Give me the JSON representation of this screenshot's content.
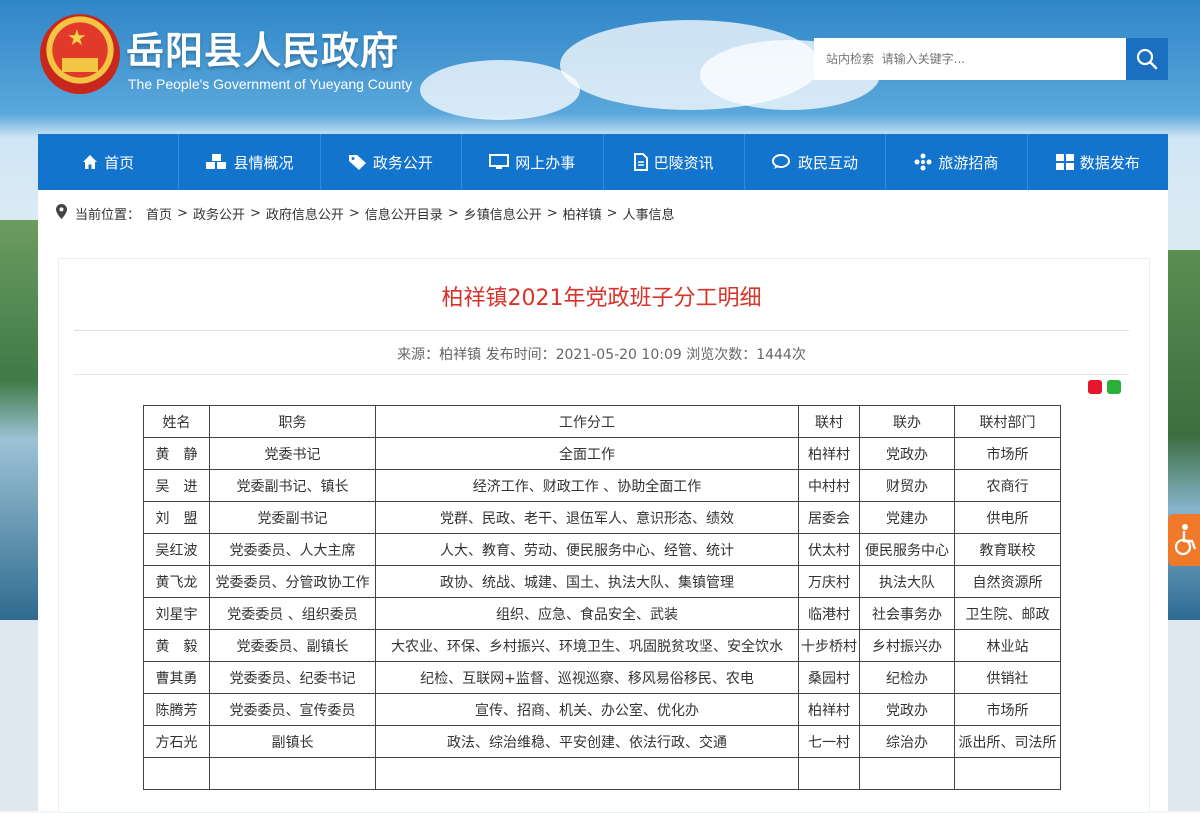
{
  "header": {
    "title": "岳阳县人民政府",
    "subtitle": "The People's Government of Yueyang County",
    "search_placeholder": "站内检索  请输入关键字..."
  },
  "nav": [
    {
      "label": "首页",
      "icon": "home-icon"
    },
    {
      "label": "县情概况",
      "icon": "cubes-icon"
    },
    {
      "label": "政务公开",
      "icon": "tag-icon"
    },
    {
      "label": "网上办事",
      "icon": "monitor-icon"
    },
    {
      "label": "巴陵资讯",
      "icon": "document-icon"
    },
    {
      "label": "政民互动",
      "icon": "chat-icon"
    },
    {
      "label": "旅游招商",
      "icon": "pinwheel-icon"
    },
    {
      "label": "数据发布",
      "icon": "grid-icon"
    }
  ],
  "breadcrumb": {
    "prefix": "当前位置：",
    "items": [
      "首页",
      "政务公开",
      "政府信息公开",
      "信息公开目录",
      "乡镇信息公开",
      "柏祥镇",
      "人事信息"
    ]
  },
  "article": {
    "title": "柏祥镇2021年党政班子分工明细",
    "meta": "来源：柏祥镇 发布时间：2021-05-20 10:09 浏览次数：1444次"
  },
  "table": {
    "headers": [
      "姓名",
      "职务",
      "工作分工",
      "联村",
      "联办",
      "联村部门"
    ],
    "rows": [
      [
        "黄　静",
        "党委书记",
        "全面工作",
        "柏祥村",
        "党政办",
        "市场所"
      ],
      [
        "吴　进",
        "党委副书记、镇长",
        "经济工作、财政工作 、协助全面工作",
        "中村村",
        "财贸办",
        "农商行"
      ],
      [
        "刘　盟",
        "党委副书记",
        "党群、民政、老干、退伍军人、意识形态、绩效",
        "居委会",
        "党建办",
        "供电所"
      ],
      [
        "吴红波",
        "党委委员、人大主席",
        "人大、教育、劳动、便民服务中心、经管、统计",
        "伏太村",
        "便民服务中心",
        "教育联校"
      ],
      [
        "黄飞龙",
        "党委委员、分管政协工作",
        "政协、统战、城建、国土、执法大队、集镇管理",
        "万庆村",
        "执法大队",
        "自然资源所"
      ],
      [
        "刘星宇",
        "党委委员 、组织委员",
        "组织、应急、食品安全、武装",
        "临港村",
        "社会事务办",
        "卫生院、邮政"
      ],
      [
        "黄　毅",
        "党委委员、副镇长",
        "大农业、环保、乡村振兴、环境卫生、巩固脱贫攻坚、安全饮水",
        "十步桥村",
        "乡村振兴办",
        "林业站"
      ],
      [
        "曹其勇",
        "党委委员、纪委书记",
        "纪检、互联网+监督、巡视巡察、移风易俗移民、农电",
        "桑园村",
        "纪检办",
        "供销社"
      ],
      [
        "陈腾芳",
        "党委委员、宣传委员",
        "宣传、招商、机关、办公室、优化办",
        "柏祥村",
        "党政办",
        "市场所"
      ],
      [
        "方石光",
        "副镇长",
        "政法、综治维稳、平安创建、依法行政、交通",
        "七一村",
        "综治办",
        "派出所、司法所"
      ],
      [
        "",
        "",
        "",
        "",
        "",
        ""
      ]
    ]
  },
  "colors": {
    "nav": "#1374ce",
    "title": "#d7332b",
    "search_button": "#1a6fc0"
  }
}
